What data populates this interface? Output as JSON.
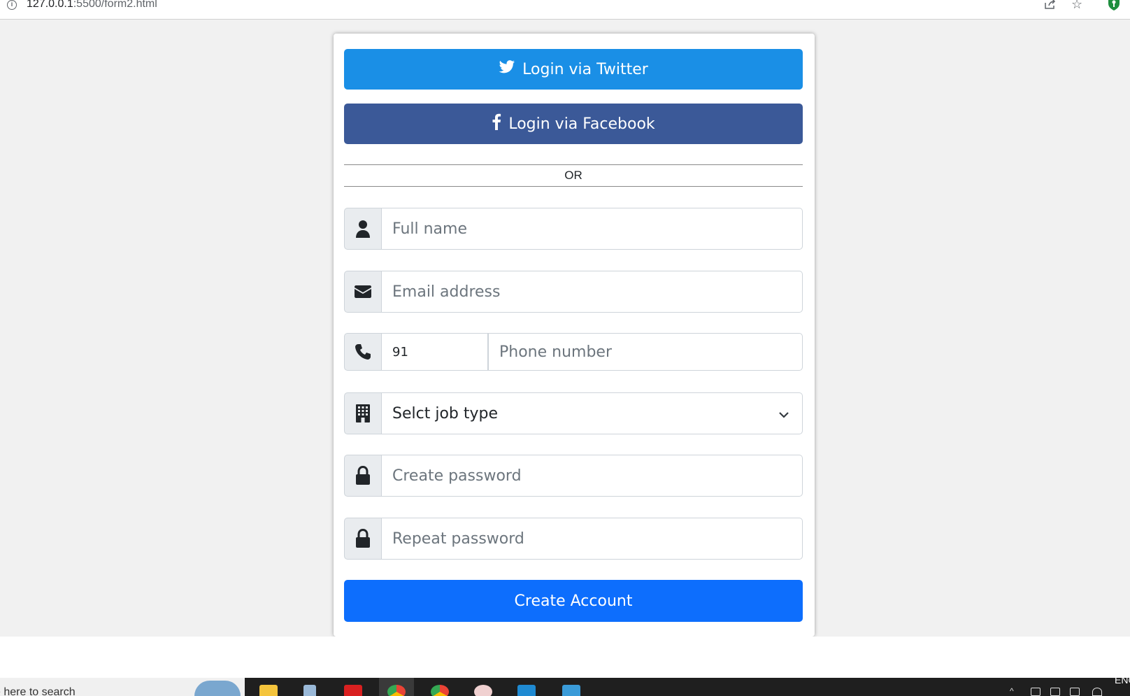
{
  "browser": {
    "url_host": "127.0.0.1",
    "url_rest": ":5500/form2.html"
  },
  "form": {
    "twitter_label": "Login via Twitter",
    "facebook_label": "Login via Facebook",
    "divider_label": "OR",
    "full_name_placeholder": "Full name",
    "email_placeholder": "Email address",
    "phone_code": "91",
    "phone_placeholder": "Phone number",
    "job_select_value": "Selct job type",
    "create_password_placeholder": "Create password",
    "repeat_password_placeholder": "Repeat password",
    "submit_label": "Create Account"
  },
  "taskbar": {
    "search_text": "e here to search",
    "language": "ENG"
  },
  "colors": {
    "twitter": "#1a8fe6",
    "facebook": "#3b5998",
    "primary": "#0d6efd"
  },
  "icons": [
    "info-icon",
    "share-icon",
    "star-icon",
    "extension-icon",
    "twitter-icon",
    "facebook-icon",
    "user-icon",
    "envelope-icon",
    "phone-icon",
    "building-icon",
    "chevron-down-icon",
    "lock-icon"
  ]
}
